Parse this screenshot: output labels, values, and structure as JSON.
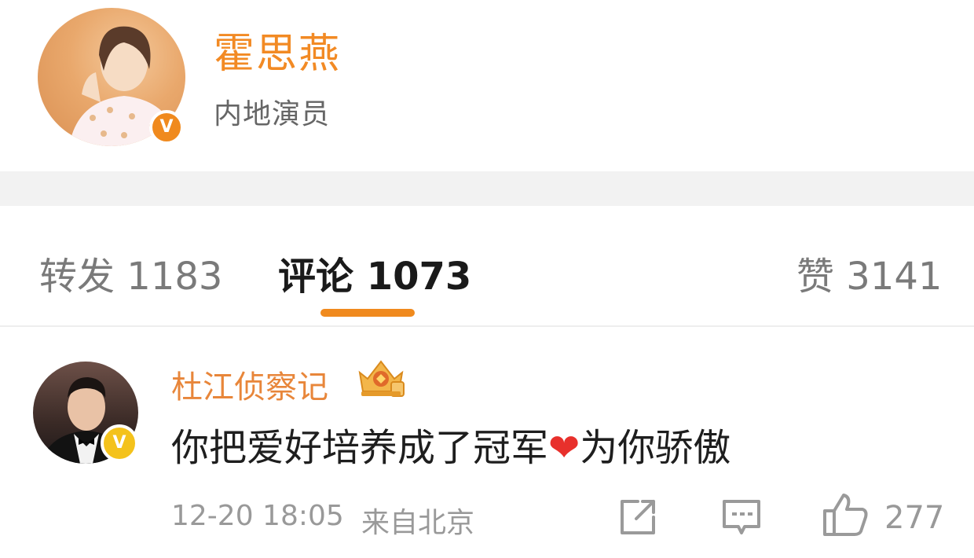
{
  "profile": {
    "name": "霍思燕",
    "description": "内地演员",
    "verified_badge": "V",
    "avatar_icon": "user-avatar",
    "accent_color": "#f08a1e"
  },
  "tabs": [
    {
      "label": "转发",
      "count": "1183",
      "active": false
    },
    {
      "label": "评论",
      "count": "1073",
      "active": true
    },
    {
      "label": "赞",
      "count": "3141",
      "active": false
    }
  ],
  "comment": {
    "author": "杜江侦察记",
    "verified_badge": "V",
    "badge_icon": "crown-fan-badge-icon",
    "text_before": "你把爱好培养成了冠军",
    "emoji": "❤",
    "text_after": "为你骄傲",
    "time": "12-20 18:05",
    "location": "来自北京",
    "actions": {
      "share_icon": "share-icon",
      "reply_icon": "comment-icon",
      "like_icon": "thumbs-up-icon",
      "like_count": "277"
    }
  }
}
